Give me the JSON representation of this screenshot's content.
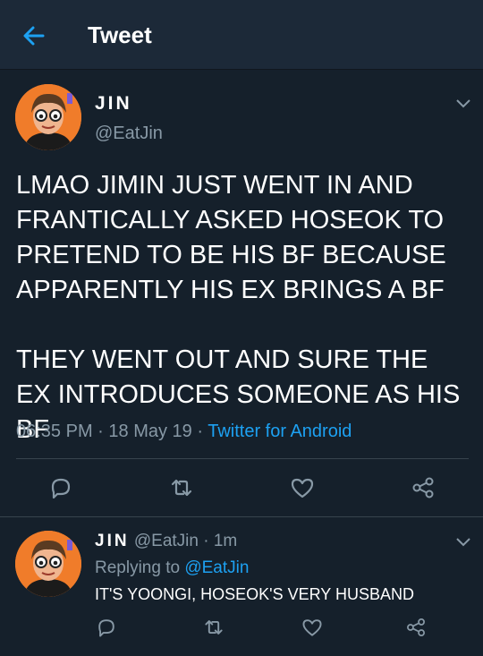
{
  "header": {
    "title": "Tweet",
    "back_icon": "arrow-left-icon",
    "accent": "#1da1f2"
  },
  "tweet": {
    "author_name": "JIN",
    "author_handle": "@EatJin",
    "text": "LMAO JIMIN JUST WENT IN AND FRANTICALLY ASKED HOSEOK TO PRETEND TO BE HIS BF BECAUSE APPARENTLY HIS EX BRINGS A BF\n\nTHEY WENT OUT AND SURE THE EX INTRODUCES SOMEONE AS HIS BF",
    "time": "06:35 PM",
    "sep1": " · ",
    "date": "18 May 19",
    "sep2": " · ",
    "source": "Twitter for Android",
    "actions": [
      "reply-icon",
      "retweet-icon",
      "like-icon",
      "share-icon"
    ]
  },
  "reply": {
    "author_name": "JIN",
    "author_handle": "@EatJin",
    "age": " · 1m",
    "replying_label": "Replying to ",
    "replying_to": "@EatJin",
    "text": "IT'S YOONGI, HOSEOK'S VERY HUSBAND",
    "actions": [
      "reply-icon",
      "retweet-icon",
      "like-icon",
      "share-icon"
    ]
  },
  "colors": {
    "background": "#15202b",
    "header_bg": "#1c2938",
    "secondary_text": "#8899a6",
    "divider": "#38444d",
    "link": "#1da1f2"
  }
}
